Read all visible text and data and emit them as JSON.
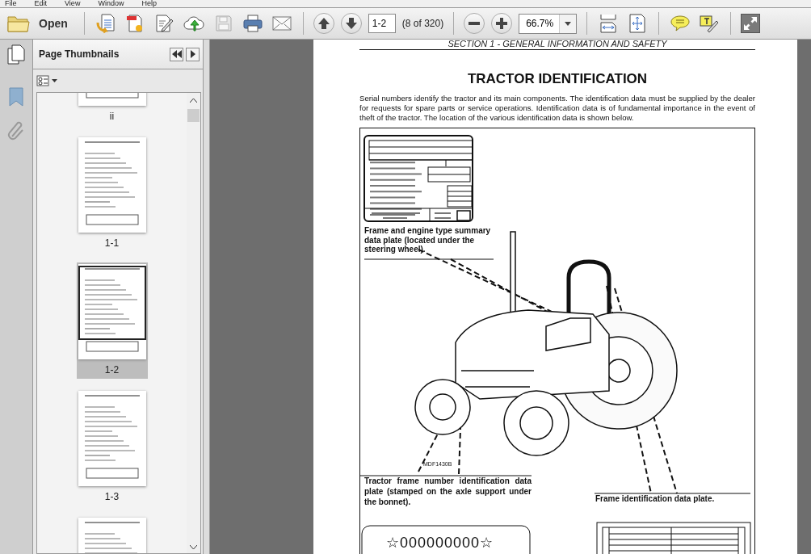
{
  "menu": [
    "File",
    "Edit",
    "View",
    "Window",
    "Help"
  ],
  "toolbar": {
    "open_label": "Open",
    "page_field": "1-2",
    "page_count": "(8 of 320)",
    "zoom_field": "66.7%"
  },
  "sidebar": {
    "title": "Page Thumbnails",
    "thumbnails": [
      {
        "label": "ii",
        "selected": false
      },
      {
        "label": "1-1",
        "selected": false
      },
      {
        "label": "1-2",
        "selected": true
      },
      {
        "label": "1-3",
        "selected": false
      },
      {
        "selected": false
      }
    ]
  },
  "document": {
    "header": "SECTION 1 - GENERAL INFORMATION AND SAFETY",
    "title": "TRACTOR IDENTIFICATION",
    "intro": "Serial numbers identify the tractor and its main components. The identification data must be supplied by the dealer for requests for spare parts or service operations. Identification data is of fundamental importance in the event of theft of the tractor. The location of the various identification data is shown below.",
    "callouts": [
      "Frame and engine type summary data plate (located under the steering wheel).",
      "Tractor frame number identification data plate (stamped on the axle support under the bonnet).",
      "Frame identification data plate."
    ],
    "figure_code": "MDF1430B",
    "plate_number": "☆000000000☆"
  }
}
